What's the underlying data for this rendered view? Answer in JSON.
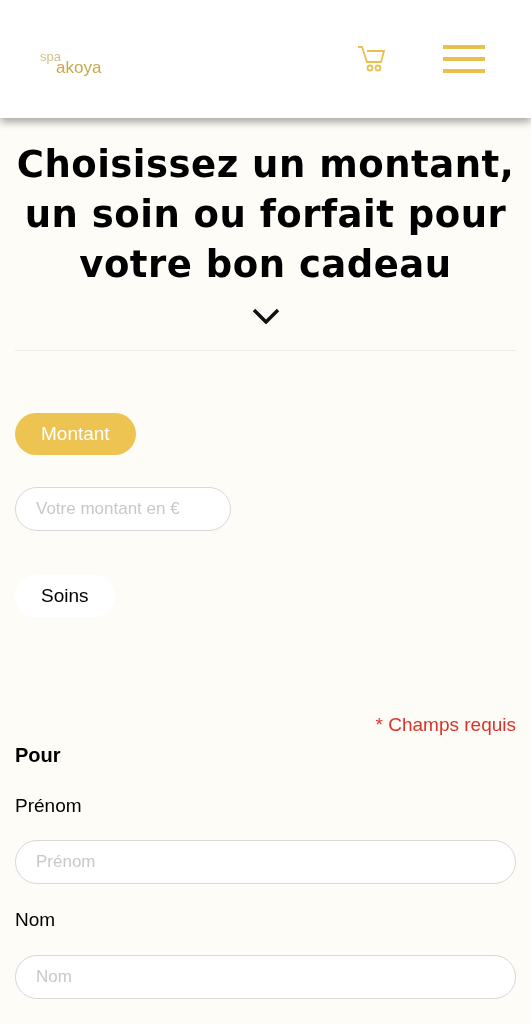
{
  "header": {
    "logo": {
      "top": "spa",
      "bottom": "akoya"
    }
  },
  "heading": "Choisissez un montant, un soin ou forfait pour votre bon cadeau",
  "options": [
    {
      "kind": "tab",
      "label": "Montant",
      "selected": true
    },
    {
      "kind": "field",
      "placeholder": "Votre montant en €"
    },
    {
      "kind": "tab",
      "label": "Soins",
      "selected": false
    }
  ],
  "required_note": "* Champs requis",
  "section_title": "Pour",
  "fields": [
    {
      "label": "Prénom",
      "placeholder": "Prénom"
    },
    {
      "label": "Nom",
      "placeholder": "Nom"
    }
  ]
}
